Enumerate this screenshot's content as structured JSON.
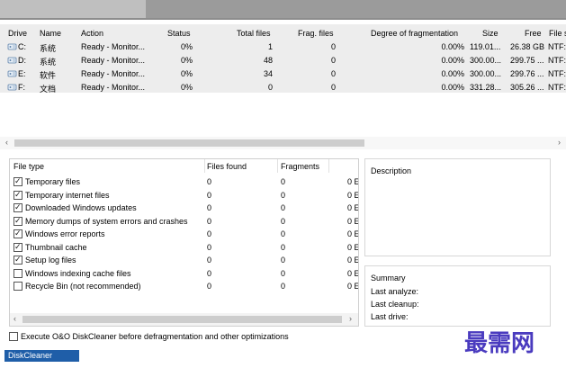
{
  "drive_table": {
    "columns": [
      "Drive",
      "Name",
      "Action",
      "Status",
      "Total files",
      "Frag. files",
      "Degree of fragmentation",
      "Size",
      "Free",
      "File s"
    ],
    "rows": [
      {
        "drive": "C:",
        "name": "系统",
        "action": "Ready - Monitor...",
        "status": "0%",
        "total_files": "1",
        "frag_files": "0",
        "degree": "0.00%",
        "size": "119.01...",
        "free": "26.38 GB",
        "fs": "NTF:"
      },
      {
        "drive": "D:",
        "name": "系统",
        "action": "Ready - Monitor...",
        "status": "0%",
        "total_files": "48",
        "frag_files": "0",
        "degree": "0.00%",
        "size": "300.00...",
        "free": "299.75 ...",
        "fs": "NTF:"
      },
      {
        "drive": "E:",
        "name": "软件",
        "action": "Ready - Monitor...",
        "status": "0%",
        "total_files": "34",
        "frag_files": "0",
        "degree": "0.00%",
        "size": "300.00...",
        "free": "299.76 ...",
        "fs": "NTF:"
      },
      {
        "drive": "F:",
        "name": "文档",
        "action": "Ready - Monitor...",
        "status": "0%",
        "total_files": "0",
        "frag_files": "0",
        "degree": "0.00%",
        "size": "331.28...",
        "free": "305.26 ...",
        "fs": "NTF:"
      }
    ]
  },
  "scroll": {
    "left_arrow": "‹",
    "right_arrow": "›"
  },
  "file_types": {
    "columns": [
      "File type",
      "Files found",
      "Fragments"
    ],
    "rows": [
      {
        "label": "Temporary files",
        "checked": true,
        "found": "0",
        "fragments": "0",
        "size": "0 E"
      },
      {
        "label": "Temporary internet files",
        "checked": true,
        "found": "0",
        "fragments": "0",
        "size": "0 E"
      },
      {
        "label": "Downloaded Windows updates",
        "checked": true,
        "found": "0",
        "fragments": "0",
        "size": "0 E"
      },
      {
        "label": "Memory dumps of system errors and crashes",
        "checked": true,
        "found": "0",
        "fragments": "0",
        "size": "0 E"
      },
      {
        "label": "Windows error reports",
        "checked": true,
        "found": "0",
        "fragments": "0",
        "size": "0 E"
      },
      {
        "label": "Thumbnail cache",
        "checked": true,
        "found": "0",
        "fragments": "0",
        "size": "0 E"
      },
      {
        "label": "Setup log files",
        "checked": true,
        "found": "0",
        "fragments": "0",
        "size": "0 E"
      },
      {
        "label": "Windows indexing cache files",
        "checked": false,
        "found": "0",
        "fragments": "0",
        "size": "0 E"
      },
      {
        "label": "Recycle Bin (not recommended)",
        "checked": false,
        "found": "0",
        "fragments": "0",
        "size": "0 E"
      }
    ]
  },
  "description": {
    "title": "Description"
  },
  "summary": {
    "title": "Summary",
    "last_analyze": "Last analyze:",
    "last_cleanup": "Last cleanup:",
    "last_drive": "Last drive:"
  },
  "execute_option": {
    "label": "Execute O&O DiskCleaner before defragmentation and other optimizations",
    "checked": false
  },
  "diskcleaner_tab": {
    "label": "DiskCleaner"
  },
  "watermark": {
    "text": "最需网"
  },
  "icons": {
    "drive": "drive-icon",
    "check": "✓"
  },
  "colors": {
    "tab_blue": "#1f5ea8",
    "watermark": "#4a3bbf",
    "drive_panel": "#ededed"
  }
}
